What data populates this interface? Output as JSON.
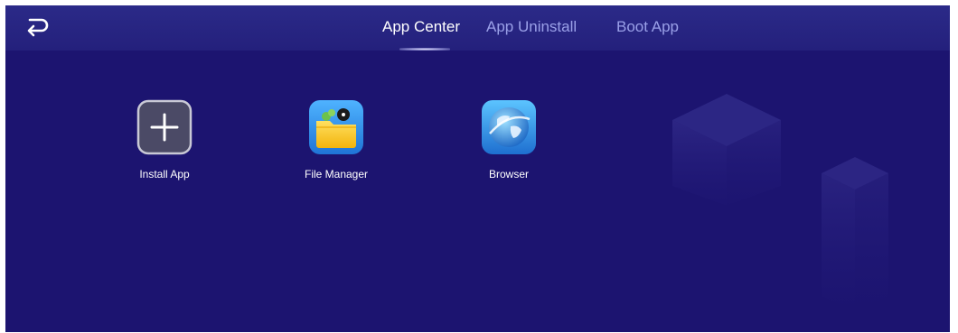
{
  "header": {
    "back_icon": "return-arrow-icon",
    "tabs": [
      {
        "label": "App Center",
        "active": true
      },
      {
        "label": "App Uninstall",
        "active": false
      },
      {
        "label": "Boot App",
        "active": false
      }
    ]
  },
  "apps": [
    {
      "label": "Install App",
      "icon": "plus-icon"
    },
    {
      "label": "File Manager",
      "icon": "folder-icon"
    },
    {
      "label": "Browser",
      "icon": "globe-icon"
    }
  ],
  "colors": {
    "background": "#1c1470",
    "header": "#2b2a88",
    "active_tab": "#ffffff",
    "inactive_tab": "#9aa0e8",
    "folder": "#f7c51e",
    "globe": "#3d9be0"
  }
}
